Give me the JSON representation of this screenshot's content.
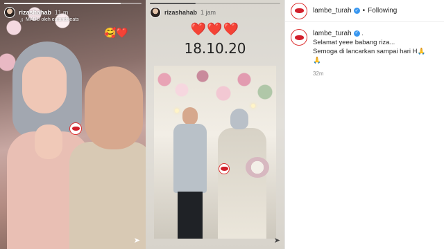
{
  "story_left": {
    "username": "rizashahab",
    "time": "11 m",
    "music": "MADU oleh eatandtreats",
    "sticker": "🥰❤️",
    "progress": 0.85
  },
  "story_right": {
    "username": "rizashahab",
    "time": "1 jam",
    "hearts": "❤️❤️❤️",
    "date": "18.10.20",
    "progress": 0.35
  },
  "post": {
    "username": "lambe_turah",
    "dot": "•",
    "follow_status": "Following",
    "caption_user": "lambe_turah",
    "caption_user_suffix": ".",
    "caption_line1": "Selamat yeee babang riza...",
    "caption_line2": "Semoga di lancarkan sampai hari H🙏",
    "caption_line3": "🙏",
    "time_ago": "32m"
  },
  "icons": {
    "send": "➤",
    "music": "♫",
    "verified": "✓"
  }
}
